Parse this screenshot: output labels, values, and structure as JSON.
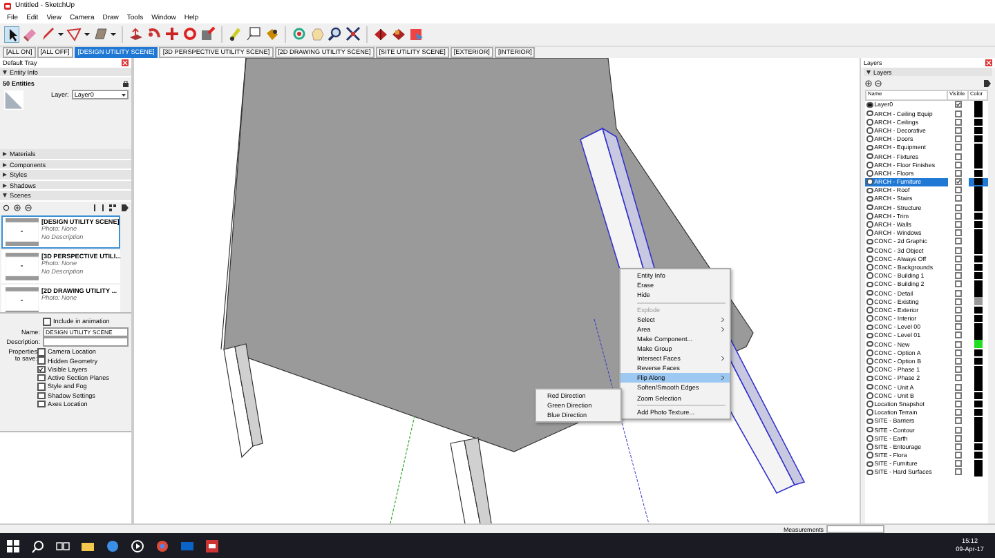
{
  "window": {
    "title": "Untitled - SketchUp"
  },
  "menu": [
    "File",
    "Edit",
    "View",
    "Camera",
    "Draw",
    "Tools",
    "Window",
    "Help"
  ],
  "scene_tabs": [
    {
      "label": "[ALL ON]",
      "selected": false
    },
    {
      "label": "[ALL OFF]",
      "selected": false
    },
    {
      "label": "[DESIGN UTILITY SCENE]",
      "selected": true
    },
    {
      "label": "[3D PERSPECTIVE UTILITY SCENE]",
      "selected": false
    },
    {
      "label": "[2D DRAWING UTILITY SCENE]",
      "selected": false
    },
    {
      "label": "[SITE UTILITY SCENE]",
      "selected": false
    },
    {
      "label": "[EXTERIOR]",
      "selected": false
    },
    {
      "label": "[INTERIOR]",
      "selected": false
    }
  ],
  "default_tray": {
    "title": "Default Tray",
    "entity_info": {
      "header": "Entity Info",
      "count": "50 Entities",
      "layer_label": "Layer:",
      "layer_value": "Layer0"
    },
    "sections": [
      {
        "label": "Materials",
        "expanded": false
      },
      {
        "label": "Components",
        "expanded": false
      },
      {
        "label": "Styles",
        "expanded": false
      },
      {
        "label": "Shadows",
        "expanded": false
      },
      {
        "label": "Scenes",
        "expanded": true
      }
    ],
    "scenes": [
      {
        "title": "[DESIGN UTILITY SCENE]",
        "photo": "Photo: None",
        "description": "No Description",
        "selected": true
      },
      {
        "title": "[3D PERSPECTIVE UTILI...",
        "photo": "Photo: None",
        "description": "No Description",
        "selected": false
      },
      {
        "title": "[2D DRAWING UTILITY ...",
        "photo": "Photo: None",
        "selected": false
      }
    ],
    "include_animation": {
      "label": "Include in animation",
      "checked": false
    },
    "name": {
      "label": "Name:",
      "value": "DESIGN UTILITY SCENE"
    },
    "description": {
      "label": "Description:"
    },
    "properties_label": "Properties to save:",
    "properties": [
      {
        "label": "Camera Location",
        "checked": false
      },
      {
        "label": "Hidden Geometry",
        "checked": false
      },
      {
        "label": "Visible Layers",
        "checked": true
      },
      {
        "label": "Active Section Planes",
        "checked": false
      },
      {
        "label": "Style and Fog",
        "checked": false
      },
      {
        "label": "Shadow Settings",
        "checked": false
      },
      {
        "label": "Axes Location",
        "checked": false
      }
    ]
  },
  "layers_panel": {
    "title": "Layers",
    "section": "Layers",
    "columns": [
      "Name",
      "Visible",
      "Color"
    ],
    "layers": [
      {
        "name": "Layer0",
        "current": true,
        "visible": true,
        "selected": false,
        "color": "#000000"
      },
      {
        "name": "ARCH - Ceiling Equip",
        "current": false,
        "visible": false,
        "selected": false,
        "color": "#000000"
      },
      {
        "name": "ARCH - Ceilings",
        "current": false,
        "visible": false,
        "selected": false,
        "color": "#000000"
      },
      {
        "name": "ARCH - Decorative",
        "current": false,
        "visible": false,
        "selected": false,
        "color": "#000000"
      },
      {
        "name": "ARCH - Doors",
        "current": false,
        "visible": false,
        "selected": false,
        "color": "#000000"
      },
      {
        "name": "ARCH - Equipment",
        "current": false,
        "visible": false,
        "selected": false,
        "color": "#000000"
      },
      {
        "name": "ARCH - Fixtures",
        "current": false,
        "visible": false,
        "selected": false,
        "color": "#000000"
      },
      {
        "name": "ARCH - Floor Finishes",
        "current": false,
        "visible": false,
        "selected": false,
        "color": "#000000"
      },
      {
        "name": "ARCH - Floors",
        "current": false,
        "visible": false,
        "selected": false,
        "color": "#000000"
      },
      {
        "name": "ARCH - Furniture",
        "current": false,
        "visible": true,
        "selected": true,
        "color": "#000000"
      },
      {
        "name": "ARCH - Roof",
        "current": false,
        "visible": false,
        "selected": false,
        "color": "#000000"
      },
      {
        "name": "ARCH - Stairs",
        "current": false,
        "visible": false,
        "selected": false,
        "color": "#000000"
      },
      {
        "name": "ARCH - Structure",
        "current": false,
        "visible": false,
        "selected": false,
        "color": "#000000"
      },
      {
        "name": "ARCH - Trim",
        "current": false,
        "visible": false,
        "selected": false,
        "color": "#000000"
      },
      {
        "name": "ARCH - Walls",
        "current": false,
        "visible": false,
        "selected": false,
        "color": "#000000"
      },
      {
        "name": "ARCH - Windows",
        "current": false,
        "visible": false,
        "selected": false,
        "color": "#000000"
      },
      {
        "name": "CONC - 2d Graphic",
        "current": false,
        "visible": false,
        "selected": false,
        "color": "#000000"
      },
      {
        "name": "CONC - 3d Object",
        "current": false,
        "visible": false,
        "selected": false,
        "color": "#000000"
      },
      {
        "name": "CONC - Always Off",
        "current": false,
        "visible": false,
        "selected": false,
        "color": "#000000"
      },
      {
        "name": "CONC - Backgrounds",
        "current": false,
        "visible": false,
        "selected": false,
        "color": "#000000"
      },
      {
        "name": "CONC - Building 1",
        "current": false,
        "visible": false,
        "selected": false,
        "color": "#000000"
      },
      {
        "name": "CONC - Building 2",
        "current": false,
        "visible": false,
        "selected": false,
        "color": "#000000"
      },
      {
        "name": "CONC - Detail",
        "current": false,
        "visible": false,
        "selected": false,
        "color": "#000000"
      },
      {
        "name": "CONC - Existing",
        "current": false,
        "visible": false,
        "selected": false,
        "color": "#999999"
      },
      {
        "name": "CONC - Exterior",
        "current": false,
        "visible": false,
        "selected": false,
        "color": "#000000"
      },
      {
        "name": "CONC - Interior",
        "current": false,
        "visible": false,
        "selected": false,
        "color": "#000000"
      },
      {
        "name": "CONC - Level 00",
        "current": false,
        "visible": false,
        "selected": false,
        "color": "#000000"
      },
      {
        "name": "CONC - Level 01",
        "current": false,
        "visible": false,
        "selected": false,
        "color": "#000000"
      },
      {
        "name": "CONC - New",
        "current": false,
        "visible": false,
        "selected": false,
        "color": "#22dd22"
      },
      {
        "name": "CONC - Option A",
        "current": false,
        "visible": false,
        "selected": false,
        "color": "#000000"
      },
      {
        "name": "CONC - Option B",
        "current": false,
        "visible": false,
        "selected": false,
        "color": "#000000"
      },
      {
        "name": "CONC - Phase 1",
        "current": false,
        "visible": false,
        "selected": false,
        "color": "#000000"
      },
      {
        "name": "CONC - Phase 2",
        "current": false,
        "visible": false,
        "selected": false,
        "color": "#000000"
      },
      {
        "name": "CONC - Unit A",
        "current": false,
        "visible": false,
        "selected": false,
        "color": "#000000"
      },
      {
        "name": "CONC - Unit B",
        "current": false,
        "visible": false,
        "selected": false,
        "color": "#000000"
      },
      {
        "name": "Location Snapshot",
        "current": false,
        "visible": false,
        "selected": false,
        "color": "#000000"
      },
      {
        "name": "Location Terrain",
        "current": false,
        "visible": false,
        "selected": false,
        "color": "#000000"
      },
      {
        "name": "SITE - Barriers",
        "current": false,
        "visible": false,
        "selected": false,
        "color": "#000000"
      },
      {
        "name": "SITE - Contour",
        "current": false,
        "visible": false,
        "selected": false,
        "color": "#000000"
      },
      {
        "name": "SITE - Earth",
        "current": false,
        "visible": false,
        "selected": false,
        "color": "#000000"
      },
      {
        "name": "SITE - Entourage",
        "current": false,
        "visible": false,
        "selected": false,
        "color": "#000000"
      },
      {
        "name": "SITE - Flora",
        "current": false,
        "visible": false,
        "selected": false,
        "color": "#000000"
      },
      {
        "name": "SITE - Furniture",
        "current": false,
        "visible": false,
        "selected": false,
        "color": "#000000"
      },
      {
        "name": "SITE - Hard Surfaces",
        "current": false,
        "visible": false,
        "selected": false,
        "color": "#000000"
      }
    ]
  },
  "context_menu": [
    {
      "kind": "item",
      "label": "Entity Info",
      "disabled": false,
      "submenu": false,
      "selected": false
    },
    {
      "kind": "item",
      "label": "Erase",
      "disabled": false,
      "submenu": false,
      "selected": false
    },
    {
      "kind": "item",
      "label": "Hide",
      "disabled": false,
      "submenu": false,
      "selected": false
    },
    {
      "kind": "separator"
    },
    {
      "kind": "item",
      "label": "Explode",
      "disabled": true,
      "submenu": false,
      "selected": false
    },
    {
      "kind": "item",
      "label": "Select",
      "disabled": false,
      "submenu": true,
      "selected": false
    },
    {
      "kind": "item",
      "label": "Area",
      "disabled": false,
      "submenu": true,
      "selected": false
    },
    {
      "kind": "item",
      "label": "Make Component...",
      "disabled": false,
      "submenu": false,
      "selected": false
    },
    {
      "kind": "item",
      "label": "Make Group",
      "disabled": false,
      "submenu": false,
      "selected": false
    },
    {
      "kind": "item",
      "label": "Intersect Faces",
      "disabled": false,
      "submenu": true,
      "selected": false
    },
    {
      "kind": "item",
      "label": "Reverse Faces",
      "disabled": false,
      "submenu": false,
      "selected": false
    },
    {
      "kind": "item",
      "label": "Flip Along",
      "disabled": false,
      "submenu": true,
      "selected": true
    },
    {
      "kind": "item",
      "label": "Soften/Smooth Edges",
      "disabled": false,
      "submenu": false,
      "selected": false
    },
    {
      "kind": "item",
      "label": "Zoom Selection",
      "disabled": false,
      "submenu": false,
      "selected": false
    },
    {
      "kind": "separator"
    },
    {
      "kind": "item",
      "label": "Add Photo Texture...",
      "disabled": false,
      "submenu": false,
      "selected": false
    }
  ],
  "submenu": [
    "Red Direction",
    "Green Direction",
    "Blue Direction"
  ],
  "status_bar": {
    "measurements_label": "Measurements"
  },
  "taskbar": {
    "time": "15:12",
    "date": "09-Apr-17"
  }
}
